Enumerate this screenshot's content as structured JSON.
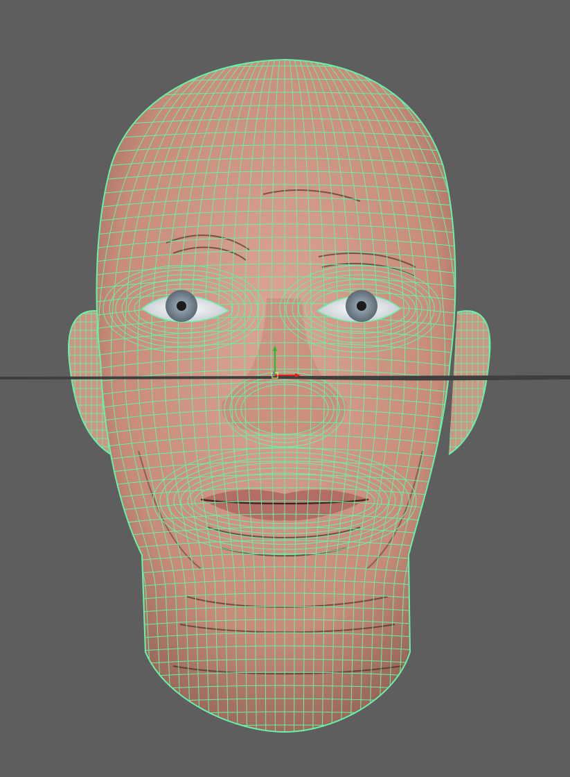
{
  "viewport": {
    "background_color": "#5e5e5e",
    "object": "head-mesh",
    "display_mode": "wireframe-on-shaded",
    "wireframe_color": "#66f2a8",
    "skin_color": "#d49a88",
    "grid_color": "#3a3a3a",
    "iris_color": "#7f8c95"
  },
  "manipulator": {
    "axes": [
      {
        "name": "x",
        "label": "",
        "color": "#e02020"
      },
      {
        "name": "y",
        "label": "",
        "color": "#20c020"
      },
      {
        "name": "z",
        "label": "z",
        "color": "#2040e0"
      }
    ]
  }
}
